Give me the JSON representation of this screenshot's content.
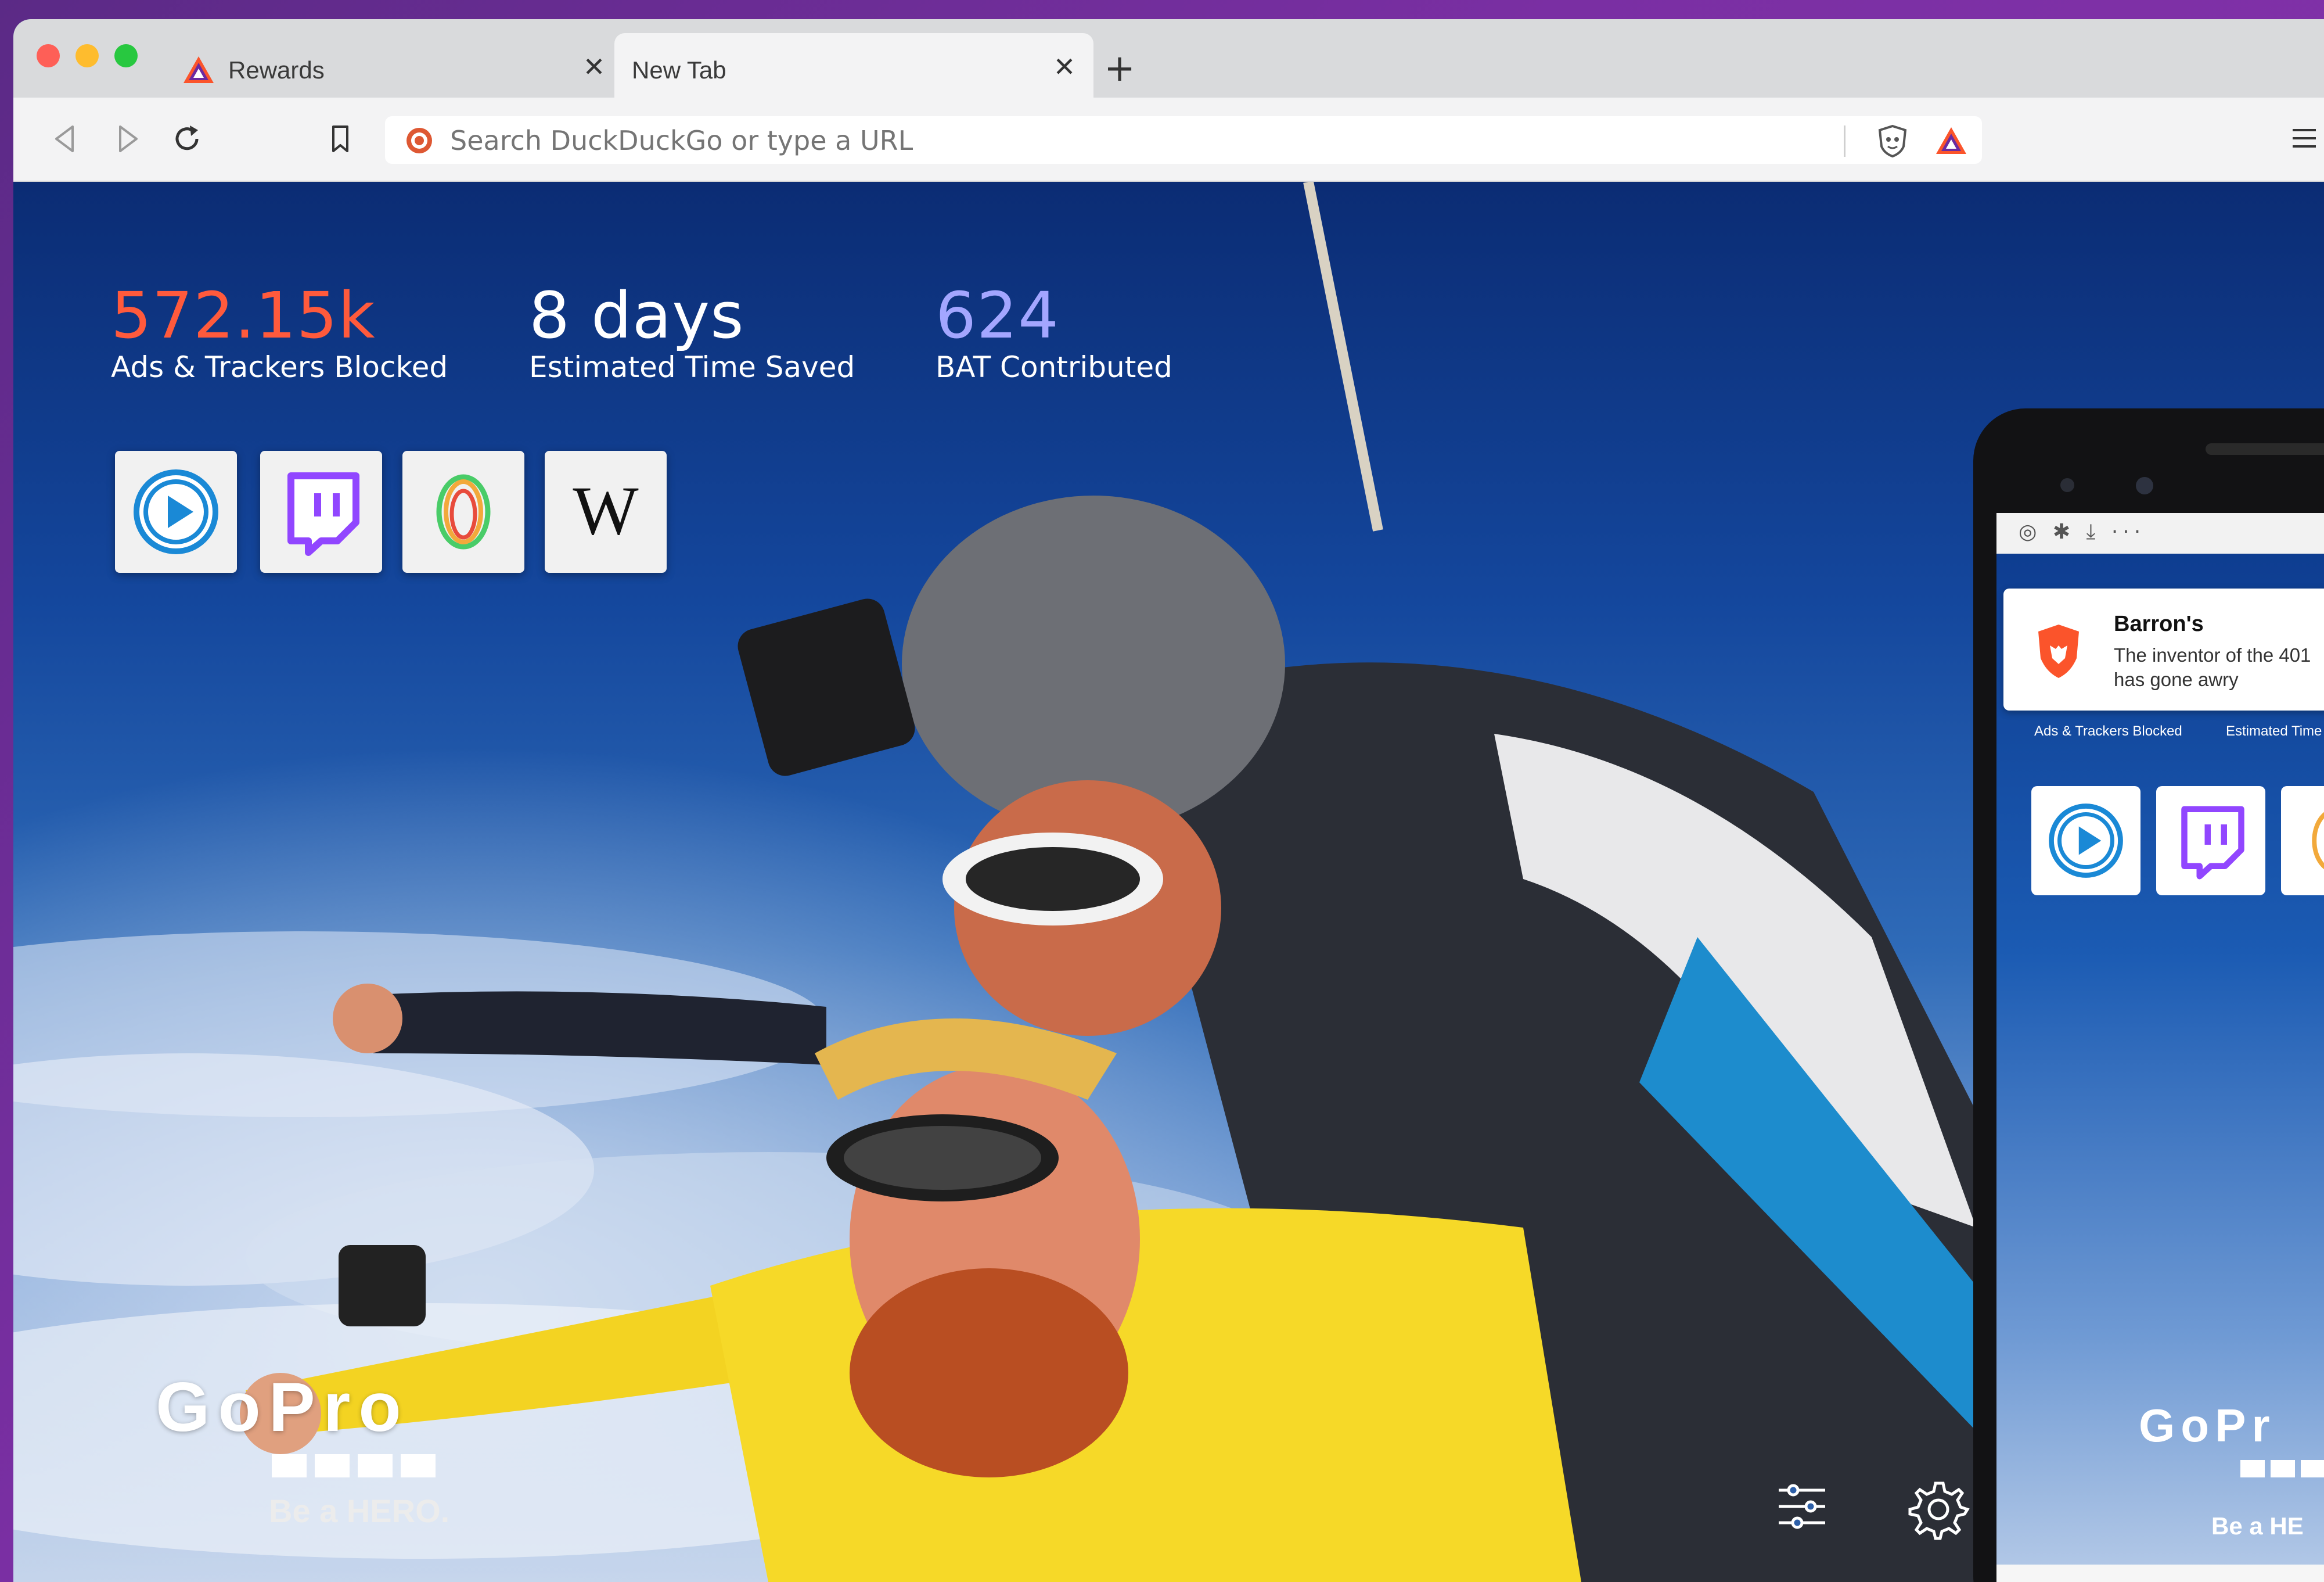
{
  "window": {
    "tabs": [
      {
        "label": "Rewards",
        "close": "✕"
      },
      {
        "label": "New Tab",
        "close": "✕"
      }
    ],
    "new_tab_symbol": "+"
  },
  "toolbar": {
    "url_placeholder": "Search DuckDuckGo or type a URL",
    "icons": [
      "back-icon",
      "forward-icon",
      "reload-icon",
      "bookmark-icon",
      "duckduckgo-icon",
      "brave-shield-icon",
      "brave-rewards-icon",
      "menu-icon"
    ]
  },
  "stats": {
    "ads_value": "572.15k",
    "ads_label": "Ads & Trackers Blocked",
    "time_value": "8 days",
    "time_label": "Estimated Time Saved",
    "bat_value": "624",
    "bat_label": "BAT Contributed"
  },
  "top_sites": [
    "play-icon",
    "twitch-icon",
    "uphold-icon",
    "wikipedia-icon"
  ],
  "sponsor": {
    "logo": "GoPro",
    "tagline": "Be a HERO."
  },
  "phone": {
    "status_icons": "◎ ✱ ⤓ ···",
    "notification_title": "Barron's",
    "notification_line1": "The inventor of the 401",
    "notification_line2": "has gone awry",
    "ads_label": "Ads & Trackers Blocked",
    "time_label": "Estimated Time",
    "brand": "GoPr",
    "tagline": "Be a HE"
  },
  "colors": {
    "ads_accent": "#ff5a3c",
    "bat_accent": "#a3a6ff",
    "desktop_bg": "#7a2fa3"
  }
}
